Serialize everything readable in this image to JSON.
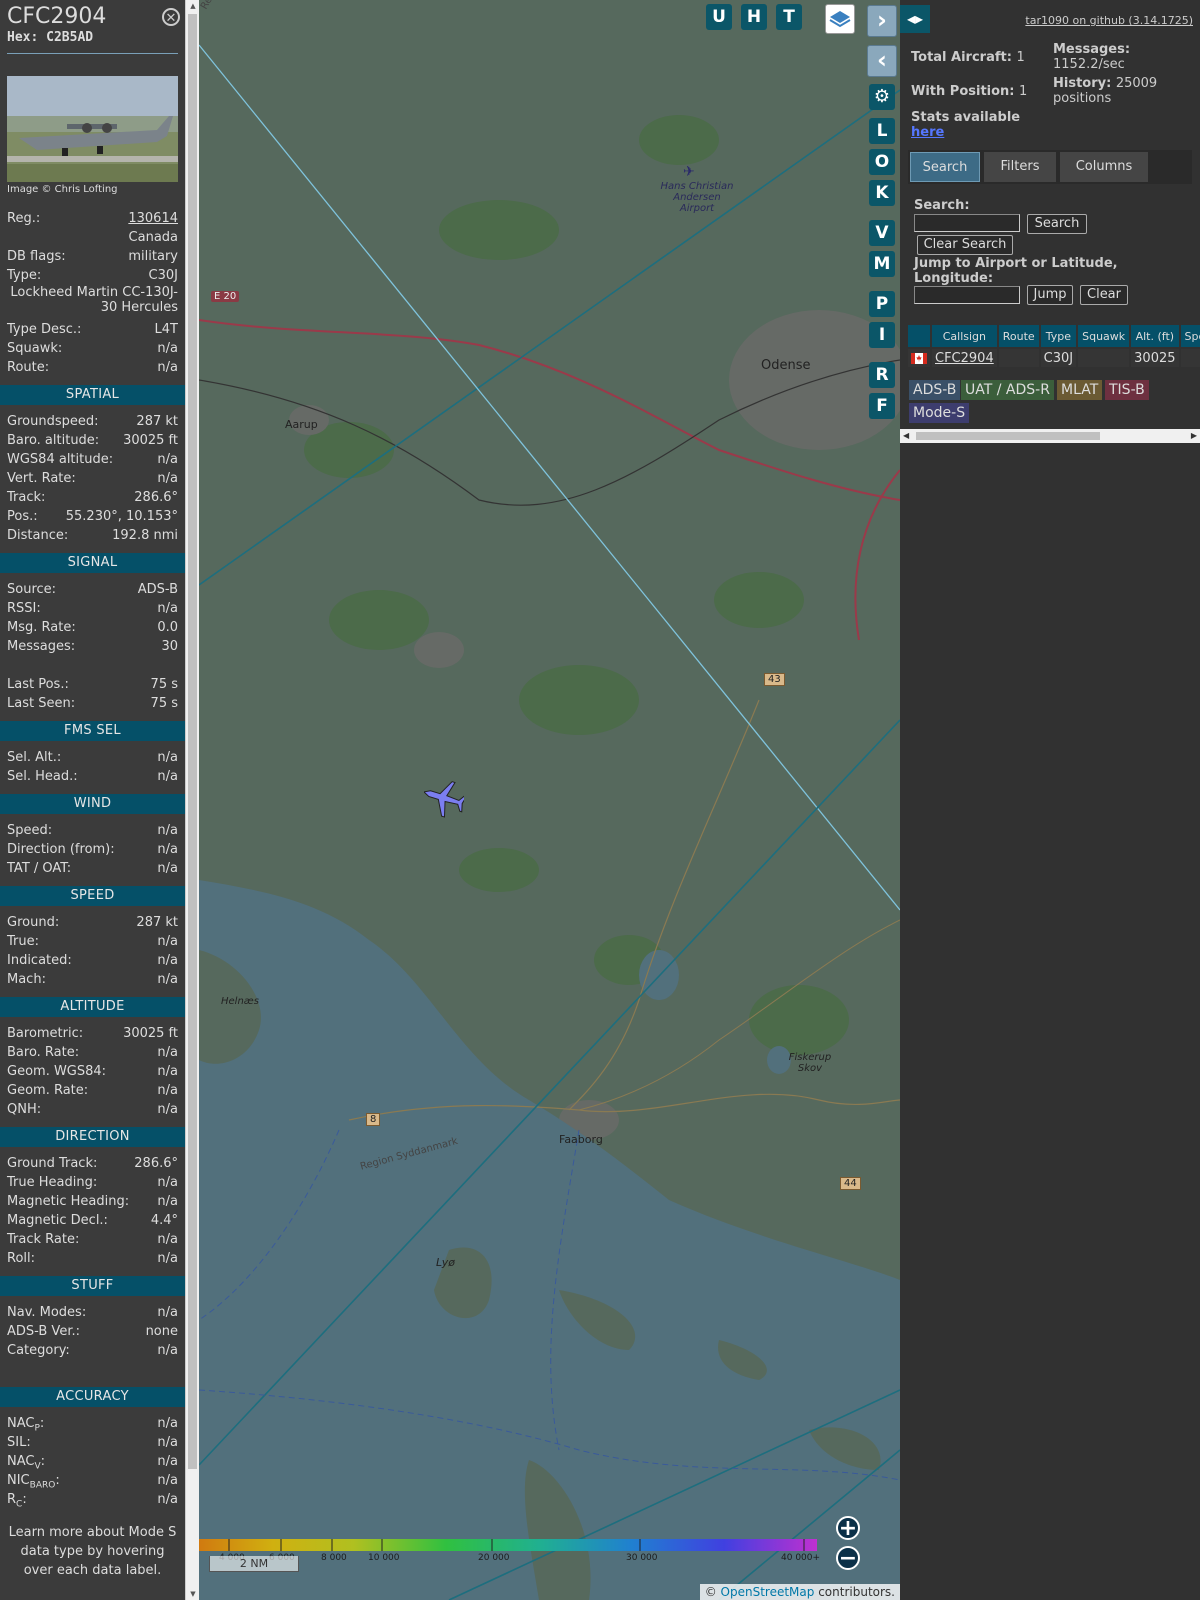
{
  "aircraft": {
    "callsign": "CFC2904",
    "hex": "Hex: C2B5AD",
    "photo_credit": "Image © Chris Lofting",
    "details": [
      {
        "label": "Reg.:",
        "value": "130614",
        "link": true
      },
      {
        "label": "",
        "value": "Canada"
      },
      {
        "label": "DB flags:",
        "value": "military"
      },
      {
        "label": "Type:",
        "value": "C30J"
      }
    ],
    "type_full": "Lockheed Martin CC-130J-30 Hercules",
    "details2": [
      {
        "label": "Type Desc.:",
        "value": "L4T"
      },
      {
        "label": "Squawk:",
        "value": "n/a"
      },
      {
        "label": "Route:",
        "value": "n/a"
      }
    ]
  },
  "sections": [
    {
      "title": "SPATIAL",
      "rows": [
        {
          "label": "Groundspeed:",
          "value": "287 kt"
        },
        {
          "label": "Baro. altitude:",
          "value": "30025 ft"
        },
        {
          "label": "WGS84 altitude:",
          "value": "n/a"
        },
        {
          "label": "Vert. Rate:",
          "value": "n/a"
        },
        {
          "label": "Track:",
          "value": "286.6°"
        },
        {
          "label": "Pos.:",
          "value": "55.230°, 10.153°"
        },
        {
          "label": "Distance:",
          "value": "192.8 nmi"
        }
      ]
    },
    {
      "title": "SIGNAL",
      "rows": [
        {
          "label": "Source:",
          "value": "ADS-B"
        },
        {
          "label": "RSSI:",
          "value": "n/a"
        },
        {
          "label": "Msg. Rate:",
          "value": "0.0"
        },
        {
          "label": "Messages:",
          "value": "30"
        },
        {
          "label": "",
          "value": ""
        },
        {
          "label": "Last Pos.:",
          "value": "75 s"
        },
        {
          "label": "Last Seen:",
          "value": "75 s"
        }
      ]
    },
    {
      "title": "FMS SEL",
      "rows": [
        {
          "label": "Sel. Alt.:",
          "value": "n/a"
        },
        {
          "label": "Sel. Head.:",
          "value": "n/a"
        }
      ]
    },
    {
      "title": "WIND",
      "rows": [
        {
          "label": "Speed:",
          "value": "n/a"
        },
        {
          "label": "Direction (from):",
          "value": "n/a"
        },
        {
          "label": "TAT / OAT:",
          "value": "n/a"
        }
      ]
    },
    {
      "title": "SPEED",
      "rows": [
        {
          "label": "Ground:",
          "value": "287 kt"
        },
        {
          "label": "True:",
          "value": "n/a"
        },
        {
          "label": "Indicated:",
          "value": "n/a"
        },
        {
          "label": "Mach:",
          "value": "n/a"
        }
      ]
    },
    {
      "title": "ALTITUDE",
      "rows": [
        {
          "label": "Barometric:",
          "value": "30025 ft"
        },
        {
          "label": "Baro. Rate:",
          "value": "n/a"
        },
        {
          "label": "Geom. WGS84:",
          "value": "n/a"
        },
        {
          "label": "Geom. Rate:",
          "value": "n/a"
        },
        {
          "label": "QNH:",
          "value": "n/a"
        }
      ]
    },
    {
      "title": "DIRECTION",
      "rows": [
        {
          "label": "Ground Track:",
          "value": "286.6°"
        },
        {
          "label": "True Heading:",
          "value": "n/a"
        },
        {
          "label": "Magnetic Heading:",
          "value": "n/a"
        },
        {
          "label": "Magnetic Decl.:",
          "value": "4.4°"
        },
        {
          "label": "Track Rate:",
          "value": "n/a"
        },
        {
          "label": "Roll:",
          "value": "n/a"
        }
      ]
    },
    {
      "title": "STUFF",
      "rows": [
        {
          "label": "Nav. Modes:",
          "value": "n/a"
        },
        {
          "label": "ADS-B Ver.:",
          "value": "none"
        },
        {
          "label": "Category:",
          "value": "n/a"
        },
        {
          "label": "",
          "value": ""
        }
      ]
    },
    {
      "title": "ACCURACY",
      "rows": [
        {
          "label": "NACP:",
          "value": "n/a"
        },
        {
          "label": "SIL:",
          "value": "n/a"
        },
        {
          "label": "NACV:",
          "value": "n/a"
        },
        {
          "label": "NICBARO:",
          "value": "n/a"
        },
        {
          "label": "RC:",
          "value": "n/a"
        }
      ]
    }
  ],
  "hint": "Learn more about Mode S data type by hovering over each data label.",
  "map": {
    "top_buttons": [
      "U",
      "H",
      "T"
    ],
    "side_buttons": [
      "L",
      "O",
      "K",
      "V",
      "M",
      "P",
      "I",
      "R",
      "F"
    ],
    "labels": {
      "airport": "Hans Christian Andersen Airport",
      "odense": "Odense",
      "aarup": "Aarup",
      "helnaes": "Helnæs",
      "faaborg": "Faaborg",
      "lyo": "Lyø",
      "fiskerup": "Fiskerup Skov",
      "region_top": "Region Syddanmark",
      "region_bottom": "Region Syddanmark",
      "e20": "E 20",
      "r43": "43",
      "r44": "44",
      "r8": "8"
    },
    "color_scale_ticks": [
      "4 000",
      "6 000",
      "8 000",
      "10 000",
      "20 000",
      "30 000",
      "40 000+"
    ],
    "scale_bar": "2 NM",
    "attribution_prefix": "© ",
    "attribution_link": "OpenStreetMap",
    "attribution_suffix": " contributors."
  },
  "right": {
    "version": "tar1090 on github (3.14.1725)",
    "total_aircraft_label": "Total Aircraft:",
    "total_aircraft": "1",
    "with_position_label": "With Position:",
    "with_position": "1",
    "messages_label": "Messages:",
    "messages": "1152.2/sec",
    "history_label": "History:",
    "history": "25009 positions",
    "stats_label": "Stats available",
    "stats_link": "here",
    "tabs": [
      "Search",
      "Filters",
      "Columns"
    ],
    "search_label": "Search:",
    "search_button": "Search",
    "clear_search_button": "Clear Search",
    "jump_label": "Jump to Airport or Latitude, Longitude:",
    "jump_button": "Jump",
    "clear_button": "Clear",
    "table_headers": [
      "",
      "Callsign",
      "Route",
      "Type",
      "Squawk",
      "Alt. (ft)",
      "Spd"
    ],
    "table_rows": [
      {
        "callsign": "CFC2904",
        "route": "",
        "type": "C30J",
        "squawk": "",
        "alt": "30025",
        "spd": ""
      }
    ],
    "source_badges": [
      {
        "label": "ADS-B",
        "color": "#3a5068"
      },
      {
        "label": "UAT / ADS-R",
        "color": "#3b5e3b"
      },
      {
        "label": "MLAT",
        "color": "#6b5a33"
      },
      {
        "label": "TIS-B",
        "color": "#6e3040"
      },
      {
        "label": "Mode-S",
        "color": "#3d3d6e"
      }
    ]
  }
}
